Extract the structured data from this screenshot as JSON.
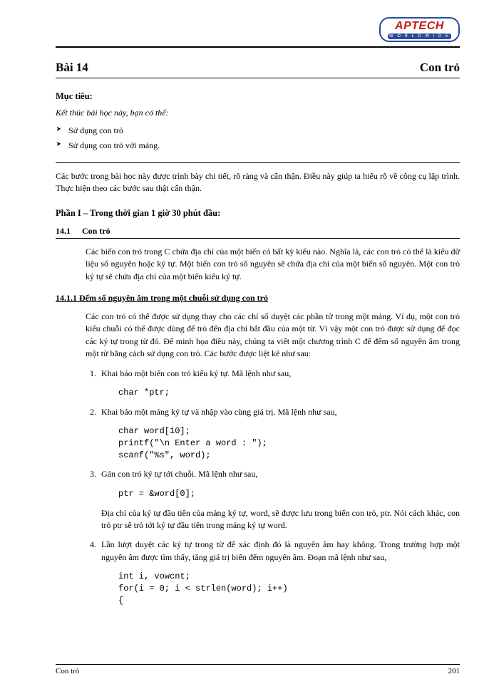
{
  "logo": {
    "top": "APTECH",
    "bottom": "W O R L D W I D E"
  },
  "lesson": {
    "left": "Bài 14",
    "right": "Con trỏ"
  },
  "objectives": {
    "heading": "Mục tiêu:",
    "lead": "Kết thúc bài học này, bạn có thể:",
    "items": [
      "Sử dụng con trỏ",
      "Sử dụng con trỏ với mảng."
    ]
  },
  "intro": "Các bước trong bài học này được trình bày chi tiết, rõ ràng và cẩn thận. Điều này giúp ta hiểu rõ về công cụ lập trình. Thực hiện theo các bước sau thật cẩn thận.",
  "part_heading": "Phần I – Trong thời gian 1 giờ 30 phút đầu:",
  "sec14": {
    "number": "14.1",
    "title": "Con trỏ"
  },
  "p14_1": "Các biến con trỏ trong C chứa địa chỉ của một biến có bất kỳ kiểu nào. Nghĩa là, các con trỏ có thể là kiểu dữ liệu số nguyên hoặc ký tự. Một biến con trỏ số nguyên sẽ chứa địa chỉ của một biến số nguyên. Một con trỏ ký tự sẽ chứa địa chỉ của một biến kiểu ký tự.",
  "sec14_1_1": "14.1.1  Đếm số nguyên âm trong một chuỗi sử dụng con trỏ",
  "p14_1_1": "Các con trỏ có thể được sử dụng thay cho các chỉ số duyệt các phần tử trong một mảng. Ví dụ, một con trỏ kiểu chuỗi có thể được dùng để trỏ đến địa chỉ bắt đầu của một từ. Vì vậy một con trỏ được sử dụng để đọc các ký tự trong từ đó. Để minh họa điều này, chúng ta viết một chương trình C để đếm số nguyên âm trong một từ bằng cách sử dụng con trỏ. Các bước được liệt kê như sau:",
  "steps": {
    "s1": {
      "text": "Khai báo một biến con trỏ kiểu ký tự. Mã lệnh như sau,",
      "code": "char *ptr;"
    },
    "s2": {
      "text": "Khai báo một mảng ký tự và nhập vào cùng giá trị. Mã lệnh như sau,",
      "code": "char word[10];\nprintf(\"\\n Enter a word : \");\nscanf(\"%s\", word);"
    },
    "s3": {
      "text": "Gán con trỏ ký tự tới chuỗi. Mã lệnh như sau,",
      "code": "ptr = &word[0];",
      "after": "Địa chỉ của ký tự đầu tiên của mảng ký tự, word, sẽ được lưu trong biến con trỏ, ptr. Nói cách khác, con trỏ ptr sẽ trỏ tới ký tự đầu tiên trong mảng ký tự word."
    },
    "s4": {
      "text": "Lần lượt duyệt các ký tự trong từ để xác định đó là nguyên âm hay không. Trong trường hợp một nguyên âm được tìm thấy, tăng giá trị biến đếm nguyên âm. Đoạn mã lệnh như sau,",
      "code": "int i, vowcnt;\nfor(i = 0; i < strlen(word); i++)\n{"
    }
  },
  "footer": {
    "left": "Con trỏ",
    "right": "201"
  }
}
